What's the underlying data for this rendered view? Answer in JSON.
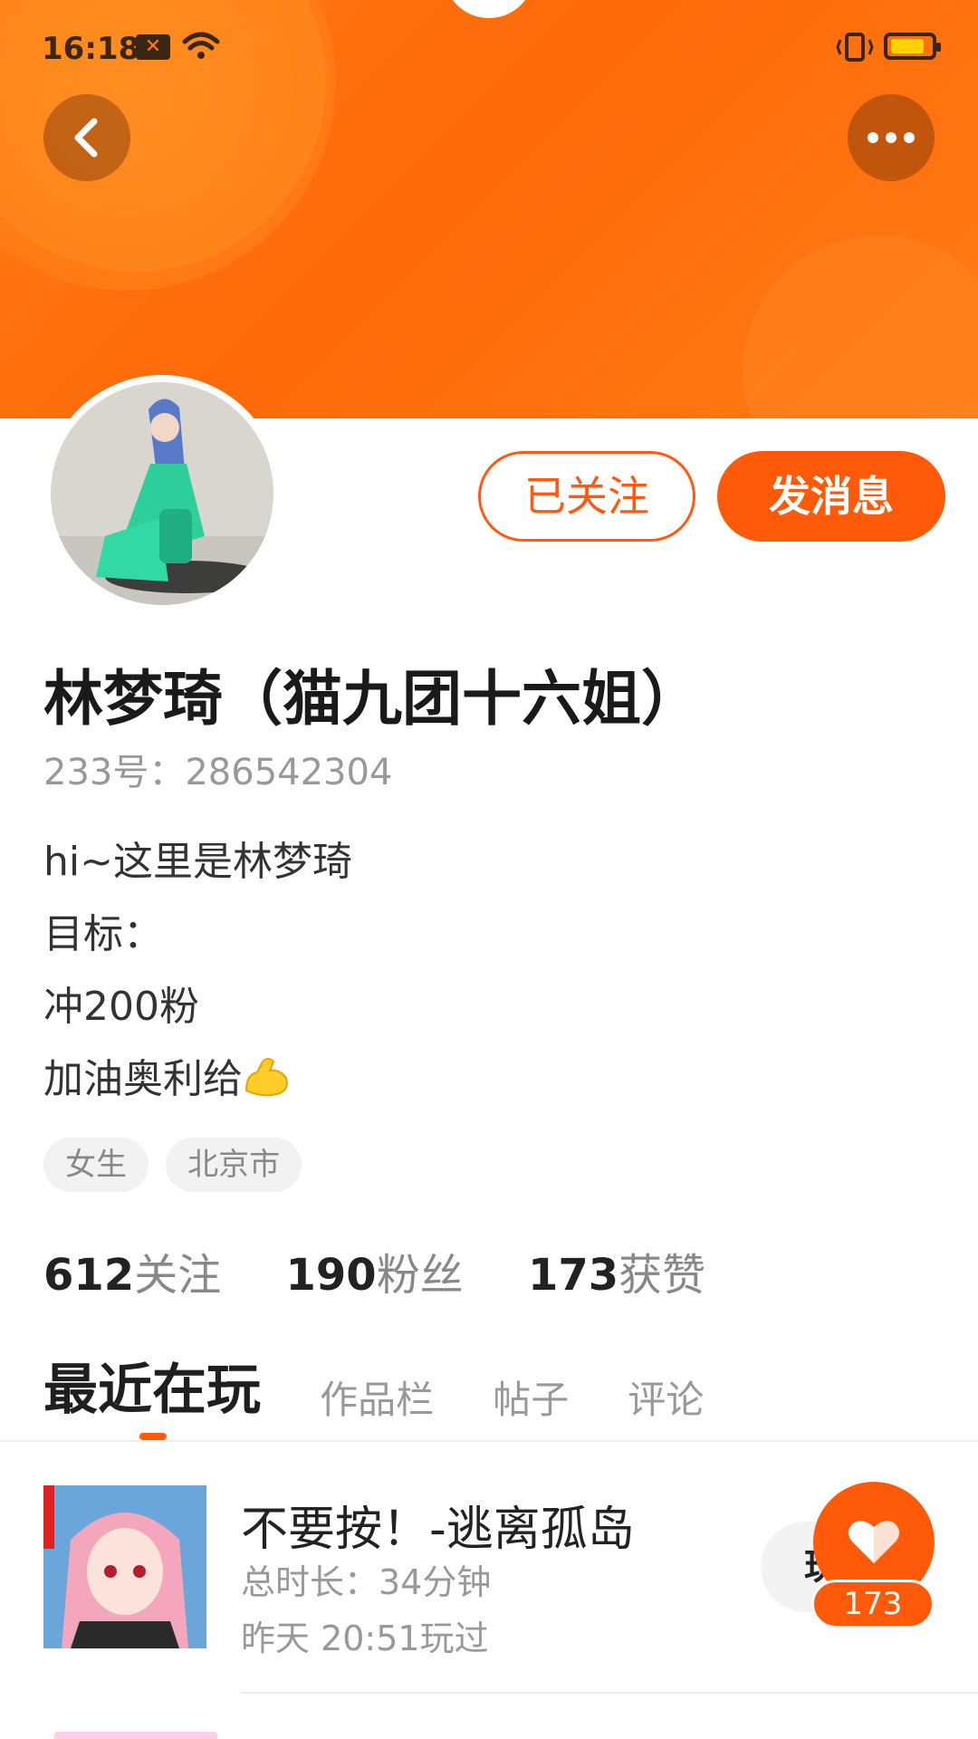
{
  "status_bar": {
    "time": "16:18"
  },
  "actions": {
    "following_label": "已关注",
    "message_label": "发消息"
  },
  "profile": {
    "name": "林梦琦（猫九团十六姐）",
    "id_text": "233号：286542304",
    "bio_lines": [
      "hi~这里是林梦琦",
      "目标：",
      "冲200粉",
      "加油奥利给"
    ],
    "bio_emoji": "flexed-biceps-emoji",
    "tags": [
      "女生",
      "北京市"
    ]
  },
  "stats": [
    {
      "value": "612",
      "label": "关注"
    },
    {
      "value": "190",
      "label": "粉丝"
    },
    {
      "value": "173",
      "label": "获赞"
    }
  ],
  "tabs": [
    {
      "label": "最近在玩",
      "active": true
    },
    {
      "label": "作品栏",
      "active": false
    },
    {
      "label": "帖子",
      "active": false
    },
    {
      "label": "评论",
      "active": false
    }
  ],
  "recent_games": [
    {
      "title": "不要按！-逃离孤岛",
      "duration": "总时长：34分钟",
      "last_played": "昨天 20:51玩过",
      "action_label": "玩"
    }
  ],
  "like_fab": {
    "count": "173"
  },
  "colors": {
    "accent": "#ff5a0a",
    "banner": "#ff7a12"
  }
}
